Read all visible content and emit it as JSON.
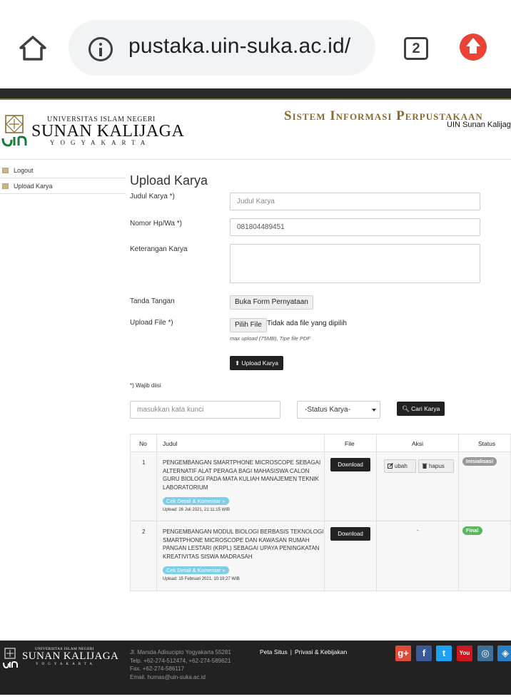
{
  "browser": {
    "url": "pustaka.uin-suka.ac.id/",
    "tab_count": "2"
  },
  "header": {
    "univ_line1": "UNIVERSITAS ISLAM NEGERI",
    "univ_line2": "SUNAN KALIJAGA",
    "univ_line3": "YOGYAKARTA",
    "system_title": "Sistem Informasi Perpustakaan",
    "system_subtitle": "UIN Sunan Kalijaga"
  },
  "sidebar": {
    "items": [
      {
        "label": "Logout"
      },
      {
        "label": "Upload Karya"
      }
    ]
  },
  "form": {
    "title": "Upload Karya",
    "judul_label": "Judul Karya *)",
    "judul_placeholder": "Judul Karya",
    "nomor_label": "Nomor Hp/Wa *)",
    "nomor_value": "081804489451",
    "keterangan_label": "Keterangan Karya",
    "tanda_tangan_label": "Tanda Tangan",
    "buka_form_button": "Buka Form Pernyataan",
    "upload_file_label": "Upload File *)",
    "pilih_file_button": "Pilih File",
    "file_status": "Tidak ada file yang dipilih",
    "upload_hint": "max upload (75MB), Tipe file PDF",
    "upload_button": "Upload Karya",
    "required_note": "*) Wajib diisi"
  },
  "search": {
    "placeholder": "masukkan kata kunci",
    "status_selected": "-Status Karya-",
    "button": "Cari Karya"
  },
  "table": {
    "headers": [
      "No",
      "Judul",
      "File",
      "Aksi",
      "Status"
    ],
    "rows": [
      {
        "no": "1",
        "judul": "PENGEMBANGAN SMARTPHONE MICROSCOPE SEBAGAI ALTERNATIF ALAT PERAGA BAGI MAHASISWA CALON GURU BIOLOGI PADA MATA KULIAH MANAJEMEN TEKNIK LABORATORIUM",
        "detail": "Cek Detail & Komentar »",
        "upload": "Upload: 26 Juli 2021, 21:11:15 WIB",
        "file_button": "Download",
        "edit_button": "ubah",
        "delete_button": "hapus",
        "aksi_text": "",
        "status": "Inisialisasi",
        "status_color": "#999999"
      },
      {
        "no": "2",
        "judul": "PENGEMBANGAN MODUL BIOLOGI BERBASIS TEKNOLOGI SMARTPHONE MICROSCOPE DAN KAWASAN RUMAH PANGAN LESTARI (KRPL) SEBAGAI UPAYA PENINGKATAN KREATIVITAS SISWA MADRASAH",
        "detail": "Cek Detail & Komentar »",
        "upload": "Upload: 15 Februari 2021, 10:19:27 WIB",
        "file_button": "Download",
        "aksi_text": "-",
        "status": "Final",
        "status_color": "#5cb85c"
      }
    ]
  },
  "footer": {
    "univ_line1": "UNIVERSITAS ISLAM NEGERI",
    "univ_line2": "SUNAN KALIJAGA",
    "univ_line3": "YOGYAKARTA",
    "address": [
      "Jl. Marsda Adisucipto Yogyakarta 55281",
      "Telp. +62-274-512474, +62-274-589621",
      "Fax. +62-274-586117",
      "Email. humas@uin-suka.ac.id"
    ],
    "link_peta": "Peta Situs",
    "link_privasi": "Privasi & Kebijakan",
    "social": [
      {
        "icon": "google-plus-icon",
        "glyph": "g+",
        "color": "#dd4b39"
      },
      {
        "icon": "facebook-icon",
        "glyph": "f",
        "color": "#3b5998"
      },
      {
        "icon": "twitter-icon",
        "glyph": "t",
        "color": "#1da1f2"
      },
      {
        "icon": "youtube-icon",
        "glyph": "You",
        "color": "#cc181e"
      },
      {
        "icon": "instagram-icon",
        "glyph": "◎",
        "color": "#3f729b"
      },
      {
        "icon": "blog-icon",
        "glyph": "◈",
        "color": "#2a7ec4"
      }
    ]
  },
  "colors": {
    "brand_gold": "#8a6b2e",
    "dark": "#222222",
    "badge_blue": "#7fcde8"
  }
}
